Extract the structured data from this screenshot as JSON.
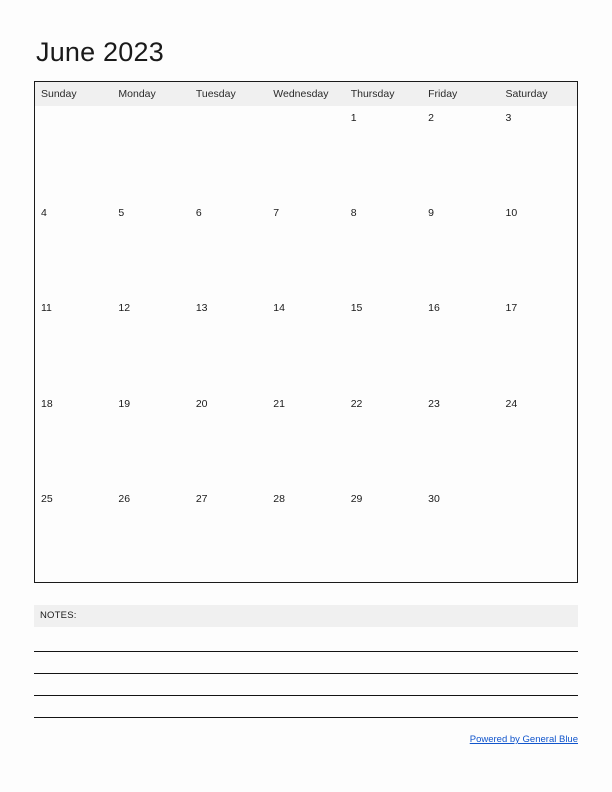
{
  "document": {
    "title": "June 2023",
    "month": "June",
    "year": "2023"
  },
  "calendar": {
    "weekdays": [
      "Sunday",
      "Monday",
      "Tuesday",
      "Wednesday",
      "Thursday",
      "Friday",
      "Saturday"
    ],
    "weeks": [
      [
        "",
        "",
        "",
        "",
        "1",
        "2",
        "3"
      ],
      [
        "4",
        "5",
        "6",
        "7",
        "8",
        "9",
        "10"
      ],
      [
        "11",
        "12",
        "13",
        "14",
        "15",
        "16",
        "17"
      ],
      [
        "18",
        "19",
        "20",
        "21",
        "22",
        "23",
        "24"
      ],
      [
        "25",
        "26",
        "27",
        "28",
        "29",
        "30",
        ""
      ]
    ]
  },
  "notes": {
    "label": "NOTES:",
    "line_count": 4
  },
  "footer": {
    "link_text": "Powered by General Blue"
  },
  "colors": {
    "page_background": "#fdfdfd",
    "header_band": "#f0f0f0",
    "border": "#1a1a1a",
    "text": "#1a1a1a",
    "link": "#1155cc"
  }
}
